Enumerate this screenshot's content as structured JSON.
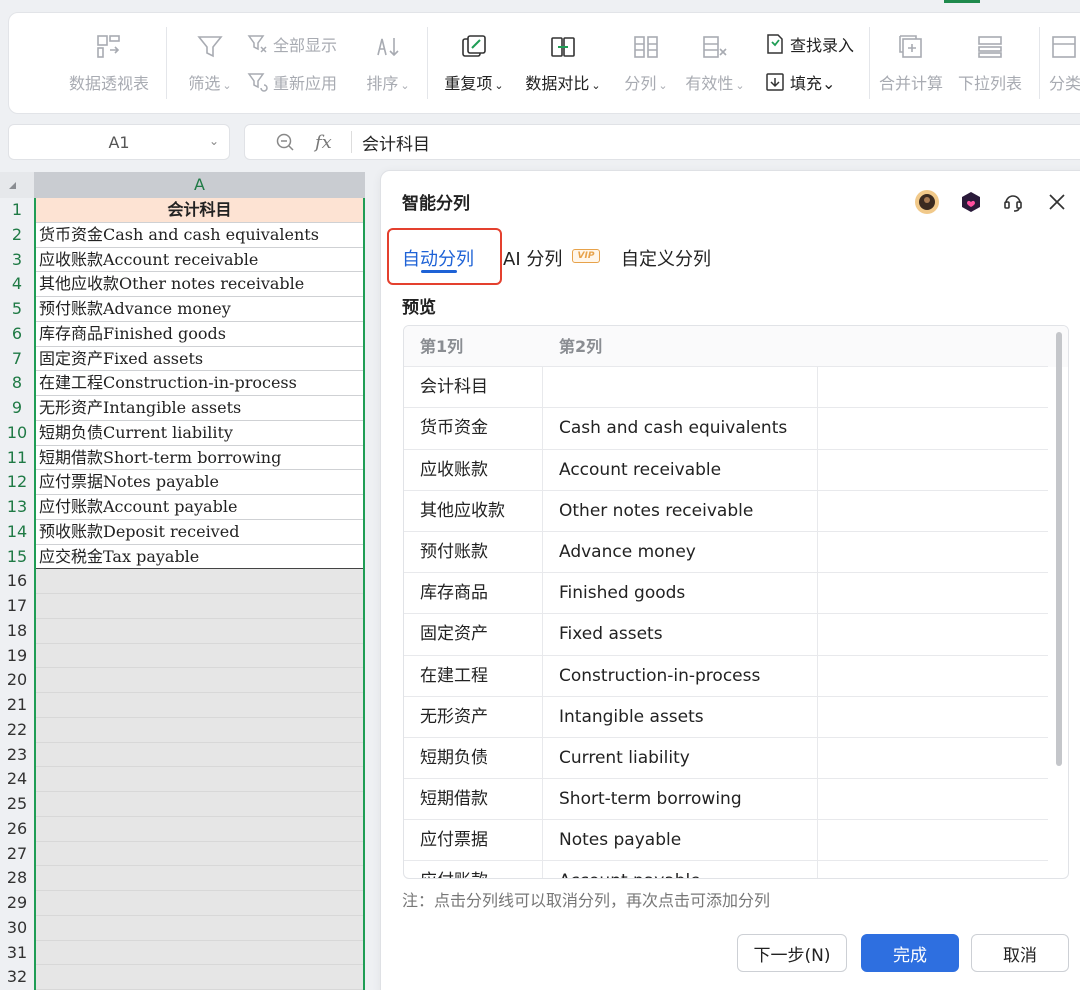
{
  "ribbon": {
    "pivot_label": "数据透视表",
    "filter_label": "筛选",
    "show_all_label": "全部显示",
    "reapply_label": "重新应用",
    "sort_label": "排序",
    "duplicates_label": "重复项",
    "compare_label": "数据对比",
    "split_label": "分列",
    "validity_label": "有效性",
    "find_entry_label": "查找录入",
    "fill_label": "填充",
    "consolidate_label": "合并计算",
    "dropdown_list_label": "下拉列表",
    "more_label": "分类"
  },
  "formula_bar": {
    "cell_ref": "A1",
    "fx": "fx",
    "content": "会计科目"
  },
  "sheet": {
    "column_header": "A",
    "row_numbers": [
      "1",
      "2",
      "3",
      "4",
      "5",
      "6",
      "7",
      "8",
      "9",
      "10",
      "11",
      "12",
      "13",
      "14",
      "15",
      "16",
      "17",
      "18",
      "19",
      "20",
      "21",
      "22",
      "23",
      "24",
      "25",
      "26",
      "27",
      "28",
      "29",
      "30",
      "31",
      "32"
    ],
    "cells": [
      "会计科目",
      "货币资金Cash and cash equivalents",
      "应收账款Account receivable",
      "其他应收款Other notes receivable",
      "预付账款Advance money",
      "库存商品Finished goods",
      "固定资产Fixed assets",
      "在建工程Construction-in-process",
      "无形资产Intangible assets",
      "短期负债Current liability",
      "短期借款Short-term borrowing",
      "应付票据Notes payable",
      "应付账款Account payable",
      "预收账款Deposit received",
      "应交税金Tax payable"
    ]
  },
  "dialog": {
    "title": "智能分列",
    "tabs": [
      "自动分列",
      "AI 分列",
      "自定义分列"
    ],
    "vip_badge": "VIP",
    "preview_label": "预览",
    "col_headers": [
      "第1列",
      "第2列"
    ],
    "rows": [
      [
        "会计科目",
        ""
      ],
      [
        "货币资金",
        "Cash and cash equivalents"
      ],
      [
        "应收账款",
        "Account receivable"
      ],
      [
        "其他应收款",
        "Other notes receivable"
      ],
      [
        "预付账款",
        "Advance money"
      ],
      [
        "库存商品",
        "Finished goods"
      ],
      [
        "固定资产",
        "Fixed assets"
      ],
      [
        "在建工程",
        "Construction-in-process"
      ],
      [
        "无形资产",
        "Intangible assets"
      ],
      [
        "短期负债",
        "Current liability"
      ],
      [
        "短期借款",
        "Short-term borrowing"
      ],
      [
        "应付票据",
        "Notes payable"
      ],
      [
        "应付账款",
        "Account payable"
      ]
    ],
    "note": "注：点击分列线可以取消分列，再次点击可添加分列",
    "next_button": "下一步(N)",
    "finish_button": "完成",
    "cancel_button": "取消"
  },
  "colors": {
    "accent_blue": "#2e6fe0",
    "highlight_red": "#e4402e",
    "selection_green": "#1f9d55",
    "header_fill": "#fde3d3"
  }
}
